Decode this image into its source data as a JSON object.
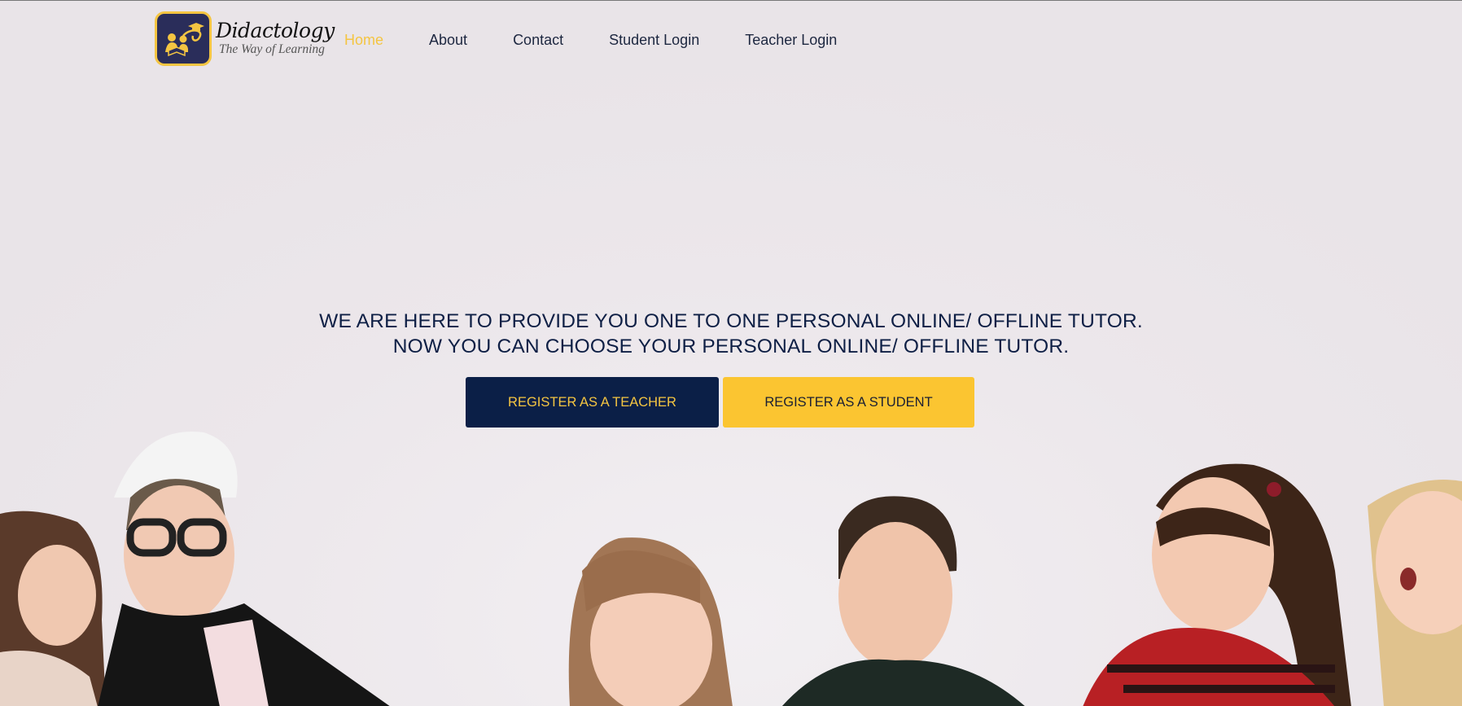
{
  "brand": {
    "name": "Didactology",
    "tagline": "The Way of Learning"
  },
  "nav": {
    "items": [
      {
        "label": "Home",
        "active": true
      },
      {
        "label": "About",
        "active": false
      },
      {
        "label": "Contact",
        "active": false
      },
      {
        "label": "Student Login",
        "active": false
      },
      {
        "label": "Teacher Login",
        "active": false
      }
    ]
  },
  "hero": {
    "line1": "WE ARE HERE TO PROVIDE YOU ONE TO ONE PERSONAL ONLINE/ OFFLINE TUTOR.",
    "line2": "NOW YOU CAN CHOOSE YOUR PERSONAL ONLINE/ OFFLINE TUTOR.",
    "register_teacher_label": "REGISTER AS A TEACHER",
    "register_student_label": "REGISTER AS A STUDENT"
  },
  "colors": {
    "accent_yellow": "#f4c542",
    "navy": "#0b1f47",
    "background": "#ebe6ea"
  },
  "icons": {
    "logo": "students-reading-graduation-cap-icon"
  }
}
